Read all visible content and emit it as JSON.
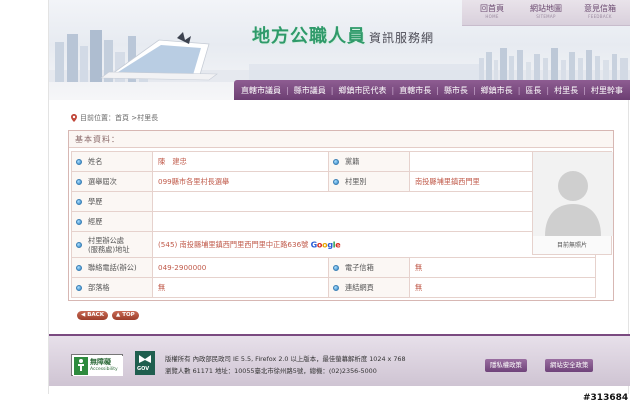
{
  "header": {
    "title": "地方公職人員",
    "subtitle": "資訊服務網",
    "toplinks": [
      {
        "label": "回首頁",
        "sub": "HOME"
      },
      {
        "label": "網站地圖",
        "sub": "SITEMAP"
      },
      {
        "label": "意見信箱",
        "sub": "FEEDBACK"
      }
    ]
  },
  "nav": {
    "items": [
      "直轄市議員",
      "縣市議員",
      "鄉鎮市民代表",
      "直轄市長",
      "縣市長",
      "鄉鎮市長",
      "區長",
      "村里長",
      "村里幹事"
    ]
  },
  "breadcrumb": {
    "text": "目前位置：首頁 >村里長"
  },
  "info": {
    "title": "基本資料：",
    "fields": {
      "name_label": "姓名",
      "name_value": "陳　建忠",
      "party_label": "黨籍",
      "party_value": "",
      "election_label": "選舉屆次",
      "election_value": "099縣市各里村長選舉",
      "village_label": "村里別",
      "village_value": "南投縣埔里鎮西門里",
      "education_label": "學歷",
      "education_value": "",
      "experience_label": "經歷",
      "experience_value": "",
      "office_label_1": "村里辦公處",
      "office_label_2": "(服務處)地址",
      "office_value": "(545) 南投縣埔里鎮西門里西門里中正路636號",
      "google_letters": [
        "G",
        "o",
        "o",
        "g",
        "l",
        "e"
      ],
      "phone_label": "聯絡電話(辦公)",
      "phone_value": "049-2900000",
      "email_label": "電子信箱",
      "email_value": "無",
      "blog_label": "部落格",
      "blog_value": "無",
      "web_label": "連結網頁",
      "web_value": "無"
    },
    "photo_caption": "目前無照片"
  },
  "buttons": {
    "back": "BACK",
    "top": "TOP"
  },
  "footer": {
    "line1": "版權所有 內政部民政司 IE 5.5, Firefox 2.0 以上版本，最佳螢幕解析度 1024 x 768",
    "line2": "瀏覽人數 61171 地址：10055臺北市徐州路5號，總機：(02)2356-5000",
    "privacy_button": "隱私權政策",
    "security_button": "網站安全政策",
    "accessibility_text_1": "無障礙",
    "accessibility_text_2": "Accessibility",
    "gov_text": "GOV"
  },
  "stamp": "#313684",
  "colors": {
    "accent_purple": "#7a4a80",
    "title_green": "#2f9a6a",
    "value_red": "#c05a4a"
  }
}
